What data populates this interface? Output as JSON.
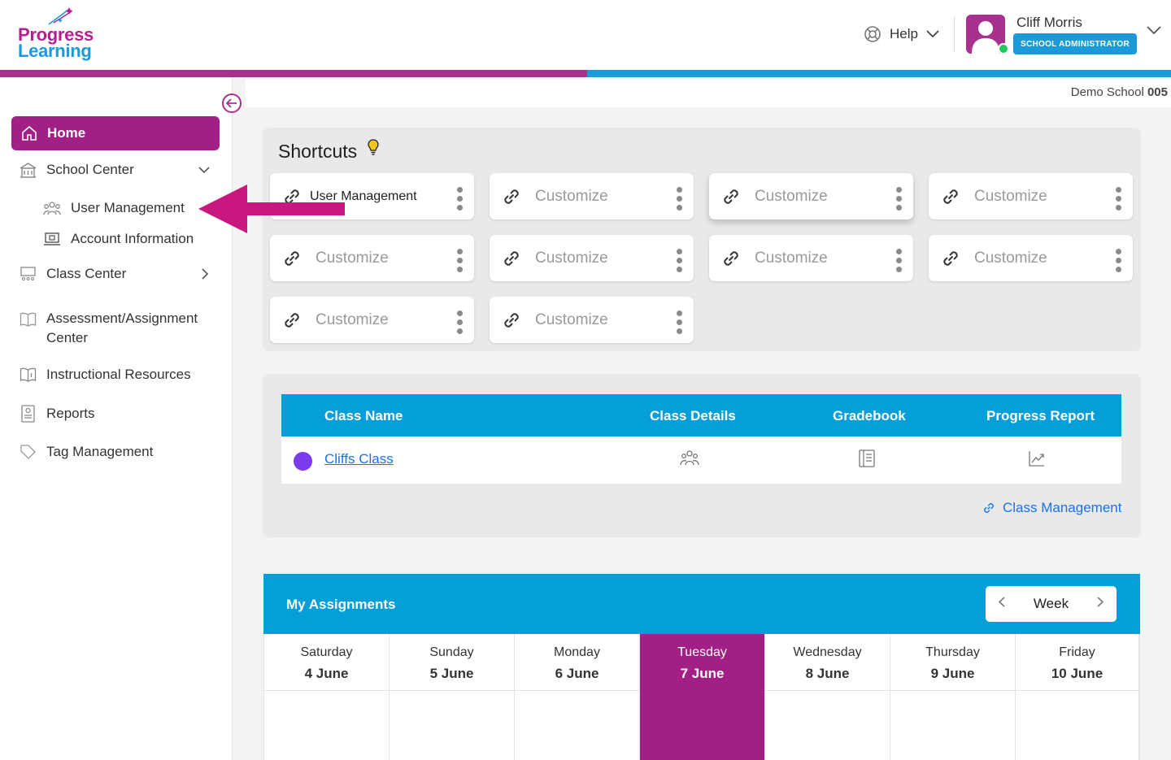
{
  "brand": {
    "line1": "Progress",
    "line2": "Learning"
  },
  "header": {
    "help_label": "Help",
    "user_name": "Cliff Morris",
    "user_role": "SCHOOL ADMINISTRATOR"
  },
  "school": {
    "prefix": "Demo School",
    "number": "005"
  },
  "sidebar": {
    "home": "Home",
    "school_center": "School Center",
    "school_center_sub": [
      "User Management",
      "Account Information"
    ],
    "class_center": "Class Center",
    "assessment_line1": "Assessment/Assignment",
    "assessment_line2": "Center",
    "instructional": "Instructional Resources",
    "reports": "Reports",
    "tags": "Tag Management"
  },
  "shortcuts": {
    "title": "Shortcuts",
    "cards": [
      "User Management",
      "Customize",
      "Customize",
      "Customize",
      "Customize",
      "Customize",
      "Customize",
      "Customize",
      "Customize",
      "Customize"
    ]
  },
  "classes": {
    "columns": [
      "Class Name",
      "Class Details",
      "Gradebook",
      "Progress Report"
    ],
    "rows": [
      {
        "name": "Cliffs Class",
        "color": "#7c3aed"
      }
    ],
    "management_link": "Class Management"
  },
  "assignments": {
    "title": "My Assignments",
    "view": "Week",
    "days": [
      {
        "day": "Saturday",
        "date": "4 June"
      },
      {
        "day": "Sunday",
        "date": "5 June"
      },
      {
        "day": "Monday",
        "date": "6 June"
      },
      {
        "day": "Tuesday",
        "date": "7 June",
        "today": true
      },
      {
        "day": "Wednesday",
        "date": "8 June"
      },
      {
        "day": "Thursday",
        "date": "9 June"
      },
      {
        "day": "Friday",
        "date": "10 June"
      }
    ]
  },
  "colors": {
    "magenta": "#a21f85",
    "blue": "#049fd8",
    "link": "#1a73e8"
  }
}
